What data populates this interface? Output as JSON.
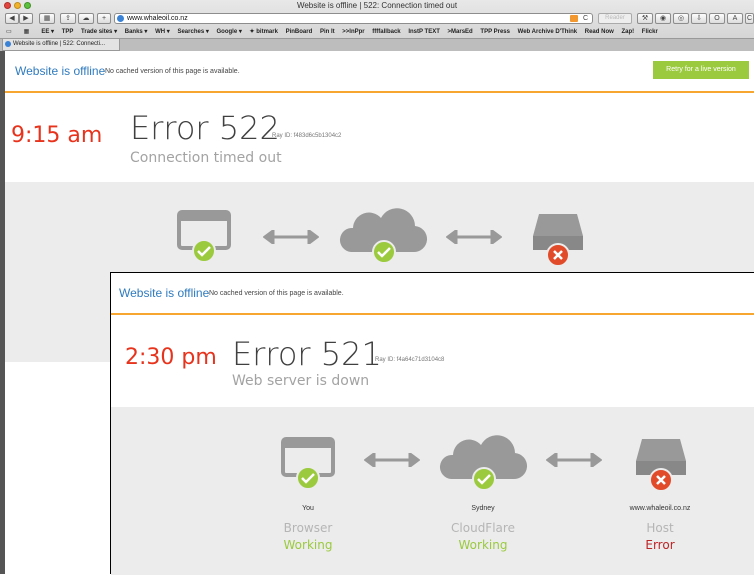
{
  "browser": {
    "window_title": "Website is offline | 522: Connection timed out",
    "url": "www.whaleoil.co.nz",
    "reader_label": "Reader",
    "bookmarks": [
      "EE ▾",
      "TPP",
      "Trade sites ▾",
      "Banks ▾",
      "WH ▾",
      "Searches ▾",
      "Google ▾",
      "✦ bitmark",
      "PinBoard",
      "Pin It",
      ">>InPpr",
      "ffffallback",
      "InstP TEXT",
      ">MarsEd",
      "TPP Press",
      "Web Archive D'Think",
      "Read Now",
      "Zap!",
      "Flickr"
    ],
    "tab_title": "Website is offline | 522: Connecti..."
  },
  "page1": {
    "offline_title": "Website is offline",
    "offline_sub": "No cached version of this page is available.",
    "retry_label": "Retry for a live version",
    "time_annotation": "9:15 am",
    "error_code": "Error 522",
    "ray_id": "Ray ID: f483d6c5b1304c2",
    "error_desc": "Connection timed out"
  },
  "page2": {
    "offline_title": "Website is offline",
    "offline_sub": "No cached version of this page is available.",
    "time_annotation": "2:30 pm",
    "error_code": "Error 521",
    "ray_id": "Ray ID: f4a64c71d3104c8",
    "error_desc": "Web server is down",
    "nodes": [
      {
        "label": "You",
        "role": "Browser",
        "status": "Working"
      },
      {
        "label": "Sydney",
        "role": "CloudFlare",
        "status": "Working"
      },
      {
        "label": "www.whaleoil.co.nz",
        "role": "Host",
        "status": "Error"
      }
    ]
  },
  "colors": {
    "accent_blue": "#2f7bbf",
    "ok_green": "#9bca3e",
    "error_red": "#bd2426",
    "annotation_red": "#e8331c",
    "orange_rule": "#f7a630"
  }
}
